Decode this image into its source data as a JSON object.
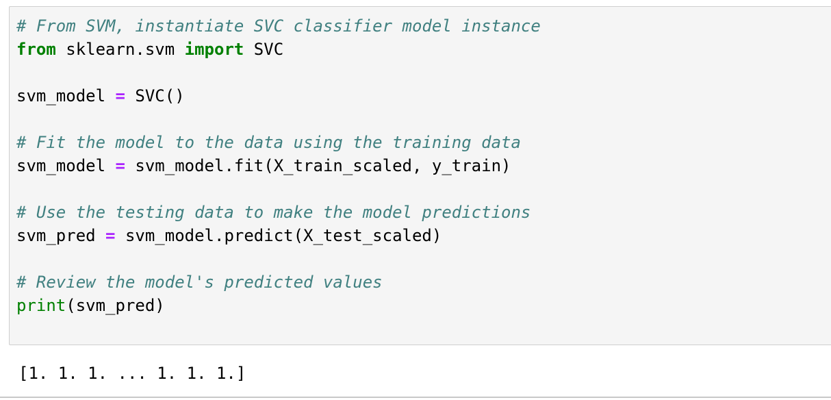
{
  "code_cell": {
    "lines": [
      [
        {
          "t": "comment",
          "text": "# From SVM, instantiate SVC classifier model instance"
        }
      ],
      [
        {
          "t": "keyword",
          "text": "from"
        },
        {
          "t": "plain",
          "text": " sklearn.svm "
        },
        {
          "t": "keyword",
          "text": "import"
        },
        {
          "t": "plain",
          "text": " SVC"
        }
      ],
      [],
      [
        {
          "t": "plain",
          "text": "svm_model "
        },
        {
          "t": "operator",
          "text": "="
        },
        {
          "t": "plain",
          "text": " SVC()"
        }
      ],
      [],
      [
        {
          "t": "comment",
          "text": "# Fit the model to the data using the training data"
        }
      ],
      [
        {
          "t": "plain",
          "text": "svm_model "
        },
        {
          "t": "operator",
          "text": "="
        },
        {
          "t": "plain",
          "text": " svm_model.fit(X_train_scaled, y_train)"
        }
      ],
      [],
      [
        {
          "t": "comment",
          "text": "# Use the testing data to make the model predictions"
        }
      ],
      [
        {
          "t": "plain",
          "text": "svm_pred "
        },
        {
          "t": "operator",
          "text": "="
        },
        {
          "t": "plain",
          "text": " svm_model.predict(X_test_scaled)"
        }
      ],
      [],
      [
        {
          "t": "comment",
          "text": "# Review the model's predicted values"
        }
      ],
      [
        {
          "t": "builtin",
          "text": "print"
        },
        {
          "t": "plain",
          "text": "(svm_pred)"
        }
      ],
      []
    ]
  },
  "output_cell": {
    "text": "[1. 1. 1. ... 1. 1. 1.]"
  },
  "colors": {
    "comment": "#408080",
    "keyword": "#008000",
    "operator": "#AA22FF",
    "builtin": "#008000",
    "cell_background": "#f5f5f5",
    "cell_border": "#cfcfcf"
  }
}
